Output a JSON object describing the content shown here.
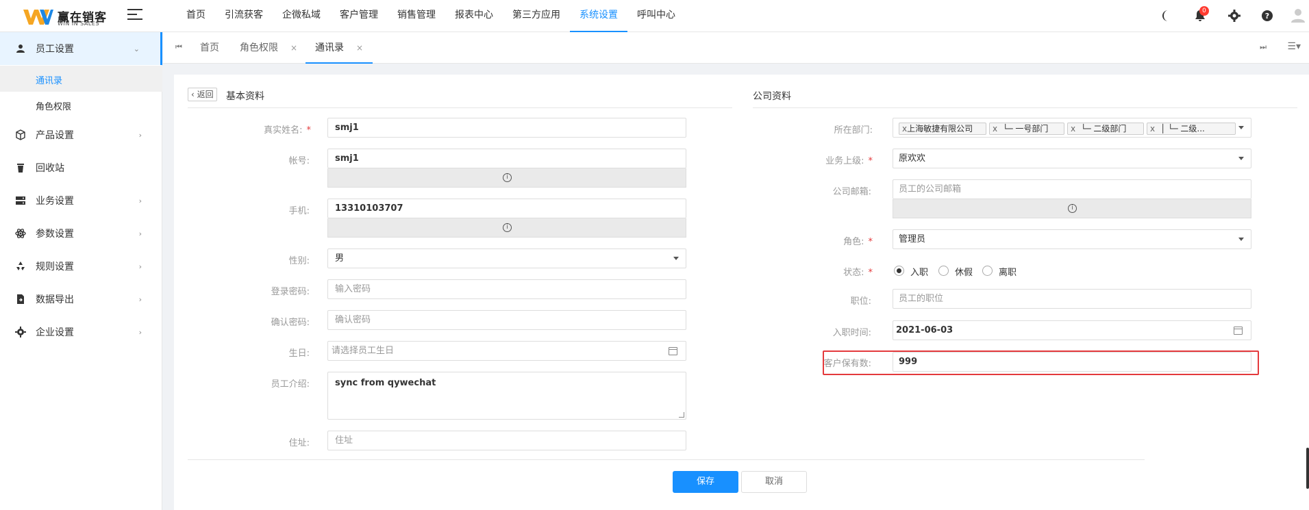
{
  "brand": {
    "name": "赢在销客",
    "sub": "WIN IN SALES",
    "accent": "#1890ff",
    "logo_yellow": "#f5a623",
    "logo_blue": "#1e88e5"
  },
  "topnav": [
    "首页",
    "引流获客",
    "企微私域",
    "客户管理",
    "销售管理",
    "报表中心",
    "第三方应用",
    "系统设置",
    "呼叫中心"
  ],
  "topnav_active": "系统设置",
  "notifications": {
    "count": "0"
  },
  "sidebar": {
    "items": [
      {
        "label": "员工设置",
        "icon": "user-icon",
        "open": true
      },
      {
        "label": "产品设置",
        "icon": "box-icon"
      },
      {
        "label": "回收站",
        "icon": "trash-icon"
      },
      {
        "label": "业务设置",
        "icon": "server-icon"
      },
      {
        "label": "参数设置",
        "icon": "atom-icon"
      },
      {
        "label": "规则设置",
        "icon": "recycle-icon"
      },
      {
        "label": "数据导出",
        "icon": "file-export-icon"
      },
      {
        "label": "企业设置",
        "icon": "gear-icon"
      }
    ],
    "subitems": [
      "通讯录",
      "角色权限"
    ],
    "active_sub": "通讯录"
  },
  "tabs": [
    {
      "label": "首页"
    },
    {
      "label": "角色权限",
      "close": "×"
    },
    {
      "label": "通讯录",
      "close": "×",
      "active": true
    }
  ],
  "basic": {
    "back_label": "返回",
    "title": "基本资料",
    "fields": {
      "real_name": {
        "label": "真实姓名:",
        "value": "smj1",
        "required": "*"
      },
      "account": {
        "label": "帐号:",
        "value": "smj1"
      },
      "phone": {
        "label": "手机:",
        "value": "13310103707"
      },
      "gender": {
        "label": "性别:",
        "value": "男"
      },
      "password": {
        "label": "登录密码:",
        "placeholder": "输入密码"
      },
      "confirm": {
        "label": "确认密码:",
        "placeholder": "确认密码"
      },
      "birthday": {
        "label": "生日:",
        "placeholder": "请选择员工生日"
      },
      "intro": {
        "label": "员工介绍:",
        "value": "sync from qywechat"
      },
      "address": {
        "label": "住址:",
        "placeholder": "住址"
      }
    }
  },
  "company": {
    "title": "公司资料",
    "fields": {
      "dept": {
        "label": "所在部门:",
        "tag_remove": "x",
        "tags": [
          "上海敏捷有限公司",
          "└─ 一号部门",
          "└─ 二级部门",
          "│  └─ 二级..."
        ]
      },
      "superior": {
        "label": "业务上级:",
        "value": "原欢欢",
        "required": "*"
      },
      "email": {
        "label": "公司邮箱:",
        "placeholder": "员工的公司邮箱"
      },
      "role": {
        "label": "角色:",
        "value": "管理员",
        "required": "*"
      },
      "status": {
        "label": "状态:",
        "required": "*",
        "options": [
          "入职",
          "休假",
          "离职"
        ],
        "selected": "入职"
      },
      "position": {
        "label": "职位:",
        "placeholder": "员工的职位"
      },
      "join_date": {
        "label": "入职时间:",
        "value": "2021-06-03"
      },
      "customer_limit": {
        "label": "客户保有数:",
        "value": "999"
      }
    }
  },
  "actions": {
    "save": "保存",
    "cancel": "取消"
  },
  "info_glyph": "i"
}
